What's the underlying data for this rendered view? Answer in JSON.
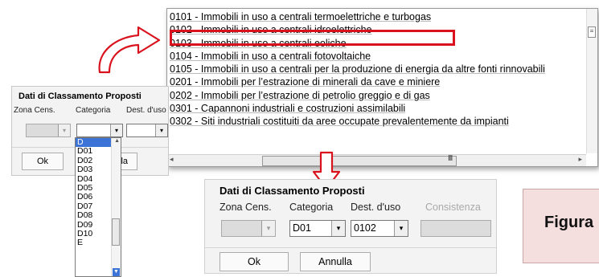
{
  "category_list": {
    "items": [
      "0101 - Immobili in uso a centrali termoelettriche e turbogas",
      "0102 - Immobili in uso a centrali idroelettriche",
      "0103 - Immobili in uso a centrali eoliche",
      "0104 - Immobili in uso a centrali fotovoltaiche",
      "0105 - Immobili in uso a centrali per la produzione di energia da altre fonti rinnovabili",
      "0201 - Immobili per l’estrazione di minerali da cave e miniere",
      "0202 - Immobili per l’estrazione di petrolio greggio e di gas",
      "0301 - Capannoni industriali e costruzioni assimilabili",
      "0302 - Siti industriali costituiti da aree occupate prevalentemente da impianti"
    ],
    "highlighted_index": 1,
    "highlight_color": "#d9121d",
    "scroll_grip": "III"
  },
  "small_form": {
    "title": "Dati di Classamento Proposti",
    "labels": {
      "zona": "Zona Cens.",
      "categoria": "Categoria",
      "dest": "Dest. d'uso"
    },
    "ok": "Ok",
    "annulla": "Annulla",
    "annulla_partial": "lla"
  },
  "dropdown": {
    "items": [
      "D",
      "D01",
      "D02",
      "D03",
      "D04",
      "D05",
      "D06",
      "D07",
      "D08",
      "D09",
      "D10",
      "E"
    ],
    "selected_index": 0,
    "accent_color": "#3b73d6"
  },
  "big_form": {
    "title": "Dati di Classamento Proposti",
    "labels": {
      "zona": "Zona Cens.",
      "categoria": "Categoria",
      "dest": "Dest. d'uso",
      "consistenza": "Consistenza"
    },
    "categoria_value": "D01",
    "dest_value": "0102",
    "ok": "Ok",
    "annulla": "Annulla"
  },
  "figura": {
    "text": "Figura"
  },
  "icons": {
    "combo_arrow": "▾",
    "arrow_up": "▲",
    "arrow_down": "▼",
    "arrow_left": "◂",
    "arrow_right": "▸"
  }
}
